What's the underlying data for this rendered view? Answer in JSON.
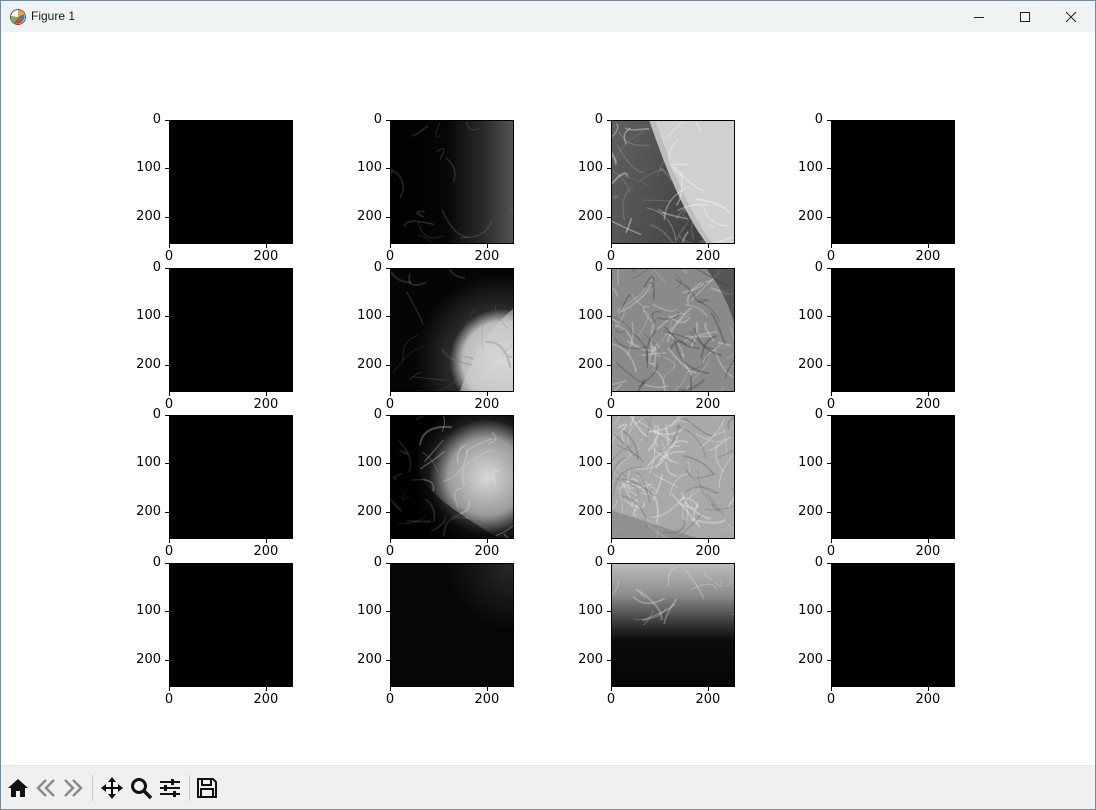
{
  "window": {
    "title": "Figure 1",
    "icons": {
      "app": "matplotlib-icon",
      "minimize": "minimize-icon",
      "maximize": "maximize-icon",
      "close": "close-icon"
    }
  },
  "figure": {
    "rows": 4,
    "cols": 4,
    "ytick_labels": [
      "0",
      "100",
      "200"
    ],
    "xtick_labels": [
      "0",
      "200"
    ],
    "panels": [
      {
        "r": 0,
        "c": 0,
        "content": "black"
      },
      {
        "r": 0,
        "c": 1,
        "content": "dark-gradient-right"
      },
      {
        "r": 0,
        "c": 2,
        "content": "bright-breast-edge"
      },
      {
        "r": 0,
        "c": 3,
        "content": "black"
      },
      {
        "r": 1,
        "c": 0,
        "content": "black"
      },
      {
        "r": 1,
        "c": 1,
        "content": "bright-bottom-right"
      },
      {
        "r": 1,
        "c": 2,
        "content": "fibrous-texture"
      },
      {
        "r": 1,
        "c": 3,
        "content": "black"
      },
      {
        "r": 2,
        "c": 0,
        "content": "black"
      },
      {
        "r": 2,
        "c": 1,
        "content": "bright-center-right"
      },
      {
        "r": 2,
        "c": 2,
        "content": "bright-texture"
      },
      {
        "r": 2,
        "c": 3,
        "content": "black"
      },
      {
        "r": 3,
        "c": 0,
        "content": "black"
      },
      {
        "r": 3,
        "c": 1,
        "content": "near-black-corner"
      },
      {
        "r": 3,
        "c": 2,
        "content": "top-tissue-band"
      },
      {
        "r": 3,
        "c": 3,
        "content": "black"
      }
    ]
  },
  "toolbar": {
    "buttons": [
      {
        "name": "home",
        "icon": "home-icon"
      },
      {
        "name": "back",
        "icon": "back-arrow-icon"
      },
      {
        "name": "forward",
        "icon": "forward-arrow-icon"
      },
      {
        "name": "pan",
        "icon": "move-icon"
      },
      {
        "name": "zoom",
        "icon": "zoom-icon"
      },
      {
        "name": "configure-subplots",
        "icon": "sliders-icon"
      },
      {
        "name": "save",
        "icon": "save-icon"
      }
    ]
  }
}
